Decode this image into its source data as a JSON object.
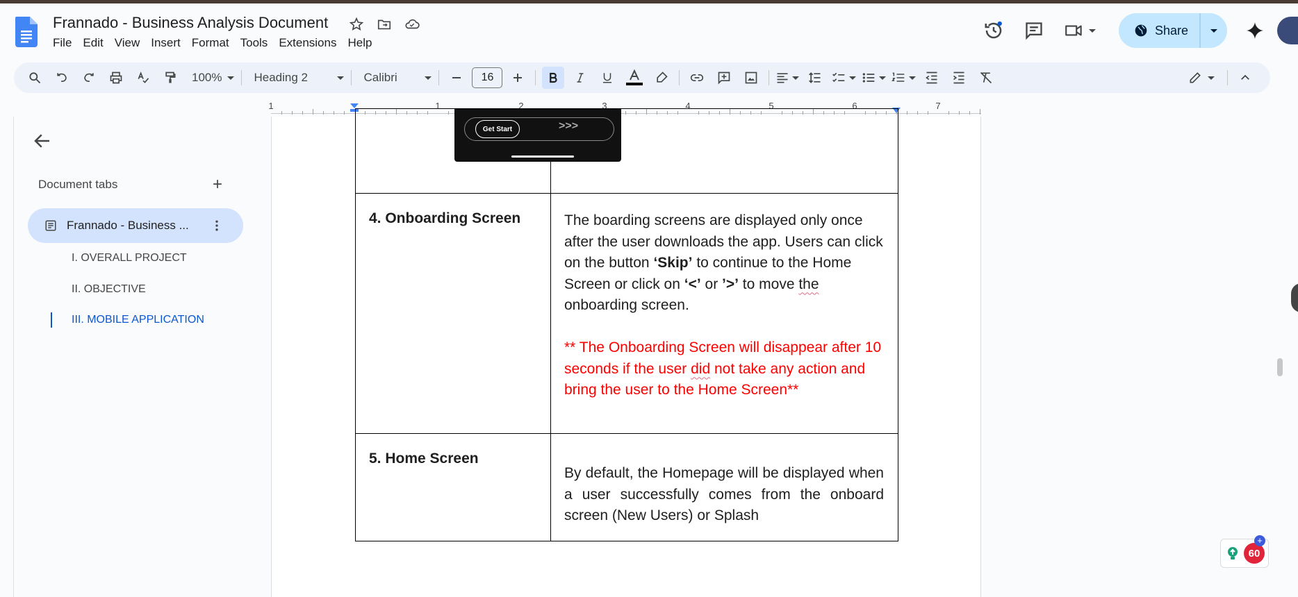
{
  "app": {
    "title": "Frannado - Business Analysis Document",
    "menu": [
      "File",
      "Edit",
      "View",
      "Insert",
      "Format",
      "Tools",
      "Extensions",
      "Help"
    ],
    "share_label": "Share"
  },
  "toolbar": {
    "zoom": "100%",
    "style": "Heading 2",
    "font": "Calibri",
    "font_size": "16"
  },
  "ruler": {
    "labels": [
      "1",
      "1",
      "2",
      "3",
      "4",
      "5",
      "6",
      "7"
    ]
  },
  "sidebar": {
    "header": "Document tabs",
    "active_tab": "Frannado - Business ...",
    "outline": [
      "I. OVERALL PROJECT",
      "II. OBJECTIVE",
      "III. MOBILE APPLICATION"
    ]
  },
  "document": {
    "thumb_button": "Get Start",
    "thumb_arrows": ">>>",
    "rows": [
      {
        "name": "4. Onboarding Screen",
        "desc_parts": [
          "The boarding screens are displayed only once after the user downloads the app. Users can click on the button ",
          "‘Skip’",
          " to continue to the Home Screen or click on ",
          "‘<’",
          " or ",
          "’>’",
          " to move ",
          "the",
          " onboarding screen."
        ],
        "note_parts": [
          "** The Onboarding Screen will disappear after 10 seconds if the user ",
          "did",
          " not take any action and bring the user to the Home Screen**"
        ]
      },
      {
        "name": "5. Home Screen",
        "desc": "By default, the Homepage will be displayed when a user successfully comes from the onboard screen (New Users) or Splash"
      }
    ]
  },
  "badge": {
    "count": "60"
  },
  "colors": {
    "accent_blue": "#0b57d0",
    "share_bg": "#c2e7ff",
    "note_red": "#ff0000"
  }
}
